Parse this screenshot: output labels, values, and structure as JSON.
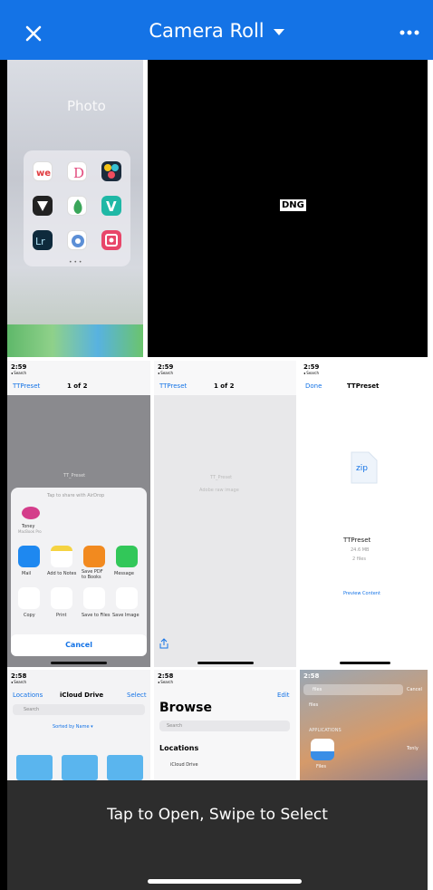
{
  "header": {
    "title": "Camera Roll",
    "bg": "#1473e6"
  },
  "tiles": {
    "photos_home": {
      "label": "Photo"
    },
    "dng": {
      "badge": "DNG"
    },
    "share_sheet": {
      "time": "2:59",
      "back": "◂ Search",
      "nav_back": "TTPreset",
      "page": "1 of 2",
      "file": "TT_Preset",
      "airdrop_hint": "Tap to share with AirDrop",
      "device": "Toney",
      "device_sub": "MacBook Pro",
      "apps": [
        "Mail",
        "Add to Notes",
        "Save PDF to Books",
        "Message"
      ],
      "actions": [
        "Copy",
        "Print",
        "Save to Files",
        "Save Image"
      ],
      "cancel": "Cancel"
    },
    "raw_preview": {
      "time": "2:59",
      "back": "◂ Search",
      "nav_back": "TTPreset",
      "page": "1 of 2",
      "file": "TT_Preset",
      "desc": "Adobe raw image"
    },
    "zip_preview": {
      "time": "2:59",
      "back": "◂ Search",
      "done": "Done",
      "title": "TTPreset",
      "ext": "zip",
      "name": "TTPreset",
      "size": "24.6 MB",
      "count": "2 files",
      "link": "Preview Content"
    },
    "icloud": {
      "time": "2:58",
      "back": "◂ Search",
      "nav_back": "Locations",
      "title": "iCloud Drive",
      "select": "Select",
      "search": "Search",
      "sort": "Sorted by Name ▾"
    },
    "browse": {
      "time": "2:58",
      "back": "◂ Search",
      "edit": "Edit",
      "title": "Browse",
      "search": "Search",
      "section": "Locations",
      "item": "iCloud Drive"
    },
    "spotlight": {
      "time": "2:58",
      "query": "files",
      "cancel": "Cancel",
      "suggest": "files",
      "section": "APPLICATIONS",
      "app": "Files",
      "right": "Tonly"
    }
  },
  "footer": {
    "message": "Tap to Open, Swipe to Select"
  }
}
